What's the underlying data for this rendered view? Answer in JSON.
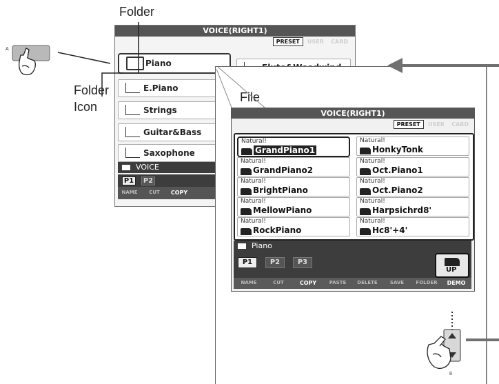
{
  "callouts": {
    "folder": "Folder",
    "folder_icon_line1": "Folder",
    "folder_icon_line2": "Icon",
    "file": "File"
  },
  "back_screen": {
    "title": "VOICE(RIGHT1)",
    "tabs": [
      "PRESET",
      "USER",
      "CARD"
    ],
    "folders": [
      "Piano",
      "E.Piano",
      "Strings",
      "Guitar&Bass",
      "Saxophone",
      "Flute&Woodwind"
    ],
    "status": "VOICE",
    "pages": [
      "P1",
      "P2"
    ],
    "functions": [
      "NAME",
      "CUT",
      "COPY"
    ]
  },
  "front_screen": {
    "title": "VOICE(RIGHT1)",
    "tabs": [
      "PRESET",
      "USER",
      "CARD"
    ],
    "files": [
      {
        "category": "Natural!",
        "name": "GrandPiano1",
        "selected": true
      },
      {
        "category": "Natural!",
        "name": "HonkyTonk"
      },
      {
        "category": "Natural!",
        "name": "GrandPiano2"
      },
      {
        "category": "Natural!",
        "name": "Oct.Piano1"
      },
      {
        "category": "Natural!",
        "name": "BrightPiano"
      },
      {
        "category": "Natural!",
        "name": "Oct.Piano2"
      },
      {
        "category": "Natural!",
        "name": "MellowPiano"
      },
      {
        "category": "Natural!",
        "name": "Harpsichrd8'"
      },
      {
        "category": "Natural!",
        "name": "RockPiano"
      },
      {
        "category": "Natural!",
        "name": "Hc8'+4'"
      }
    ],
    "status": "Piano",
    "pages": [
      "P1",
      "P2",
      "P3"
    ],
    "up_button": "UP",
    "functions": [
      "NAME",
      "CUT",
      "COPY",
      "PASTE",
      "DELETE",
      "SAVE",
      "FOLDER",
      "DEMO"
    ]
  },
  "markers": {
    "button_letter": "A",
    "scroll_number": "8"
  },
  "colors": {
    "title_bar": "#555555",
    "status_bar": "#3d3d3d",
    "highlight": "#222222",
    "arrow": "#707070"
  }
}
